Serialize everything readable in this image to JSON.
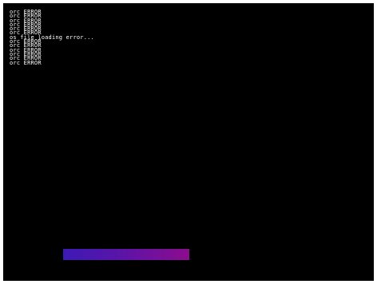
{
  "console": {
    "lines": [
      "orc ERROR",
      "orc ERROR",
      "orc ERROR",
      "orc ERROR",
      "orc ERROR",
      "orc ERROR",
      "os file loading error...",
      "orc ERROR",
      "orc ERROR",
      "orc ERROR",
      "orc ERROR",
      "orc ERROR",
      "orc ERROR"
    ]
  },
  "progress": {
    "colors": {
      "start": "#3d1ab5",
      "end": "#8a0d8c"
    }
  },
  "colors": {
    "background": "#000000",
    "text": "#ffffff"
  }
}
